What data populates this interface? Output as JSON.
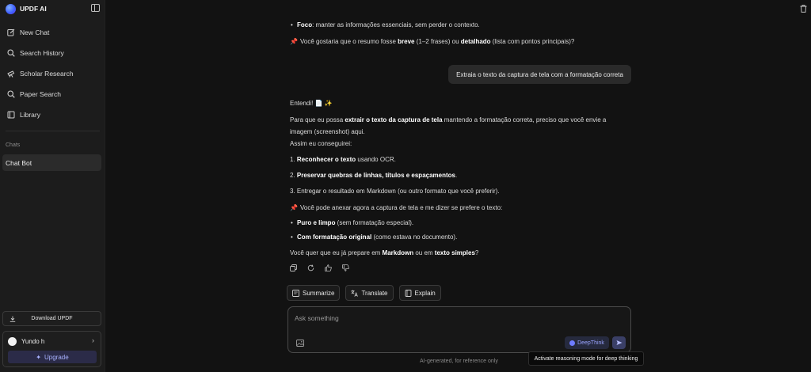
{
  "sidebar": {
    "brand": "UPDF AI",
    "nav": [
      {
        "label": "New Chat",
        "icon": "edit-icon"
      },
      {
        "label": "Search History",
        "icon": "search-icon"
      },
      {
        "label": "Scholar Research",
        "icon": "telescope-icon"
      },
      {
        "label": "Paper Search",
        "icon": "search-icon"
      },
      {
        "label": "Library",
        "icon": "library-icon"
      }
    ],
    "chats_label": "Chats",
    "active_chat": "Chat Bot",
    "download_label": "Download UPDF",
    "user_name": "Yundo h",
    "upgrade_label": "Upgrade"
  },
  "conversation": {
    "prev_bullet_bold": "Foco",
    "prev_bullet_rest": ": manter as informações essenciais, sem perder o contexto.",
    "prev_question_1": "Você gostaria que o resumo fosse ",
    "prev_question_bold1": "breve",
    "prev_question_2": " (1–2 frases) ou ",
    "prev_question_bold2": "detalhado",
    "prev_question_3": " (lista com pontos principais)?",
    "user_message": "Extraia o texto da captura de tela com a formatação correta",
    "reply": {
      "greeting": "Entendi! 📄 ✨",
      "p1_a": "Para que eu possa ",
      "p1_b": "extrair o texto da captura de tela",
      "p1_c": " mantendo a formatação correta, preciso que você envie a",
      "p1_d": "imagem (screenshot) aqui.",
      "p2": "Assim eu conseguirei:",
      "step1_a": "1. ",
      "step1_b": "Reconhecer o texto",
      "step1_c": " usando OCR.",
      "step2_a": "2. ",
      "step2_b": "Preservar quebras de linhas, títulos e espaçamentos",
      "step2_c": ".",
      "step3": "3. Entregar o resultado em Markdown (ou outro formato que você preferir).",
      "p3": "Você pode anexar agora a captura de tela e me dizer se prefere o texto:",
      "opt1_b": "Puro e limpo",
      "opt1_c": " (sem formatação especial).",
      "opt2_b": "Com formatação original",
      "opt2_c": " (como estava no documento).",
      "q_a": "Você quer que eu já prepare em ",
      "q_b": "Markdown",
      "q_c": " ou em ",
      "q_d": "texto simples",
      "q_e": "?"
    }
  },
  "quick_actions": [
    "Summarize",
    "Translate",
    "Explain"
  ],
  "composer": {
    "placeholder": "Ask something",
    "deepthink_label": "DeepThink"
  },
  "disclaimer": "AI-generated, for reference only",
  "tooltip": "Activate reasoning mode for deep thinking",
  "colors": {
    "background": "#121212",
    "sidebar": "#1c1c1c",
    "accent": "#6e7cff",
    "pin": "#e05a6a"
  }
}
